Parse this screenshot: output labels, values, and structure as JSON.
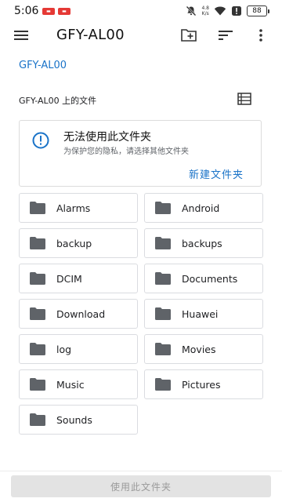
{
  "status_bar": {
    "time": "5:06",
    "net_speed_value": "4.8",
    "net_speed_unit": "K/s",
    "battery": "88"
  },
  "app_bar": {
    "title": "GFY-AL00"
  },
  "breadcrumb": "GFY-AL00",
  "list_header": "GFY-AL00 上的文件",
  "warning": {
    "title": "无法使用此文件夹",
    "subtitle": "为保护您的隐私，请选择其他文件夹",
    "action": "新建文件夹"
  },
  "folders": [
    {
      "name": "Alarms"
    },
    {
      "name": "Android"
    },
    {
      "name": "backup"
    },
    {
      "name": "backups"
    },
    {
      "name": "DCIM"
    },
    {
      "name": "Documents"
    },
    {
      "name": "Download"
    },
    {
      "name": "Huawei"
    },
    {
      "name": "log"
    },
    {
      "name": "Movies"
    },
    {
      "name": "Music"
    },
    {
      "name": "Pictures"
    },
    {
      "name": "Sounds"
    }
  ],
  "bottom_button": "使用此文件夹",
  "colors": {
    "accent": "#1a73c8",
    "folder_icon": "#5f6368",
    "disabled_button_bg": "#e3e3e3"
  }
}
